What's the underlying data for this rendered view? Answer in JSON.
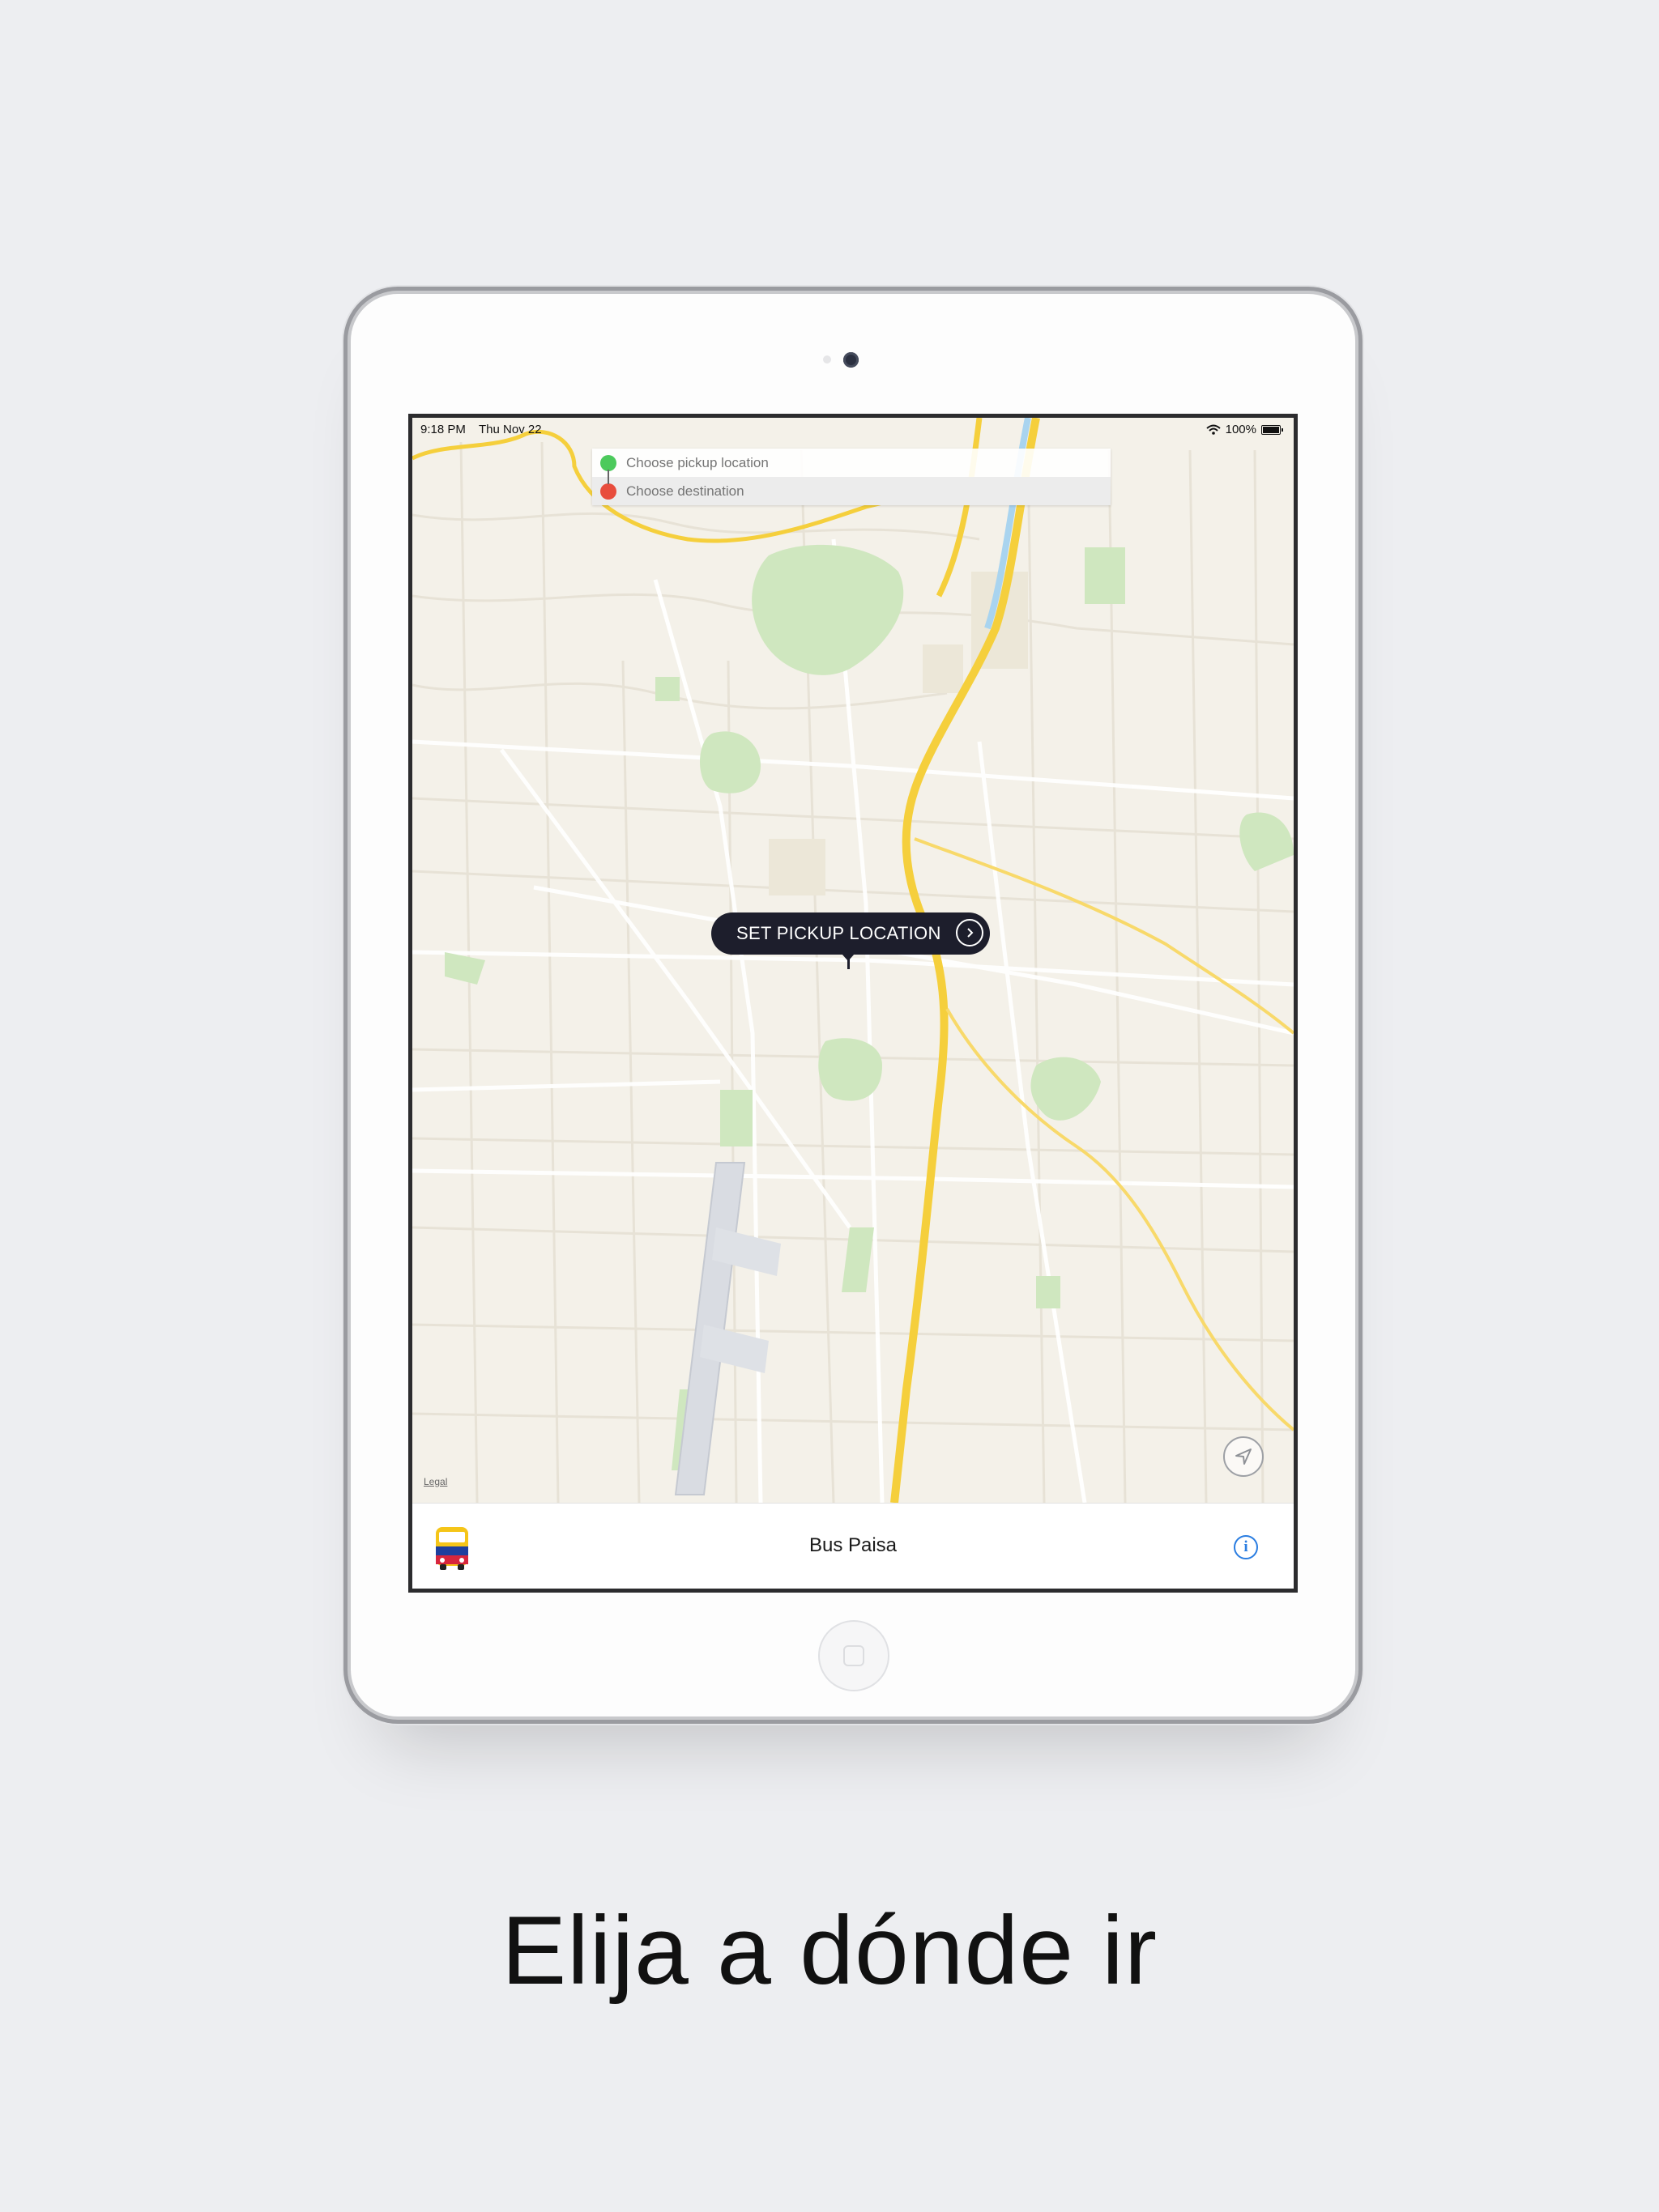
{
  "status_bar": {
    "time": "9:18 PM",
    "date": "Thu Nov 22",
    "battery": "100%"
  },
  "search": {
    "pickup_placeholder": "Choose pickup location",
    "destination_placeholder": "Choose destination"
  },
  "map": {
    "callout_label": "SET PICKUP LOCATION",
    "legal_label": "Legal"
  },
  "bottom_bar": {
    "app_title": "Bus Paisa",
    "info_glyph": "i"
  },
  "caption": "Elija a dónde ir",
  "colors": {
    "pickup_dot": "#4cca5c",
    "destination_dot": "#e84d3d",
    "callout_bg": "#1d1e2c",
    "accent_blue": "#2a7de1"
  },
  "icons": {
    "locate": "location-arrow-icon",
    "info": "info-icon",
    "app": "bus-icon",
    "wifi": "wifi-icon",
    "battery": "battery-icon",
    "chevron": "chevron-right-icon"
  }
}
